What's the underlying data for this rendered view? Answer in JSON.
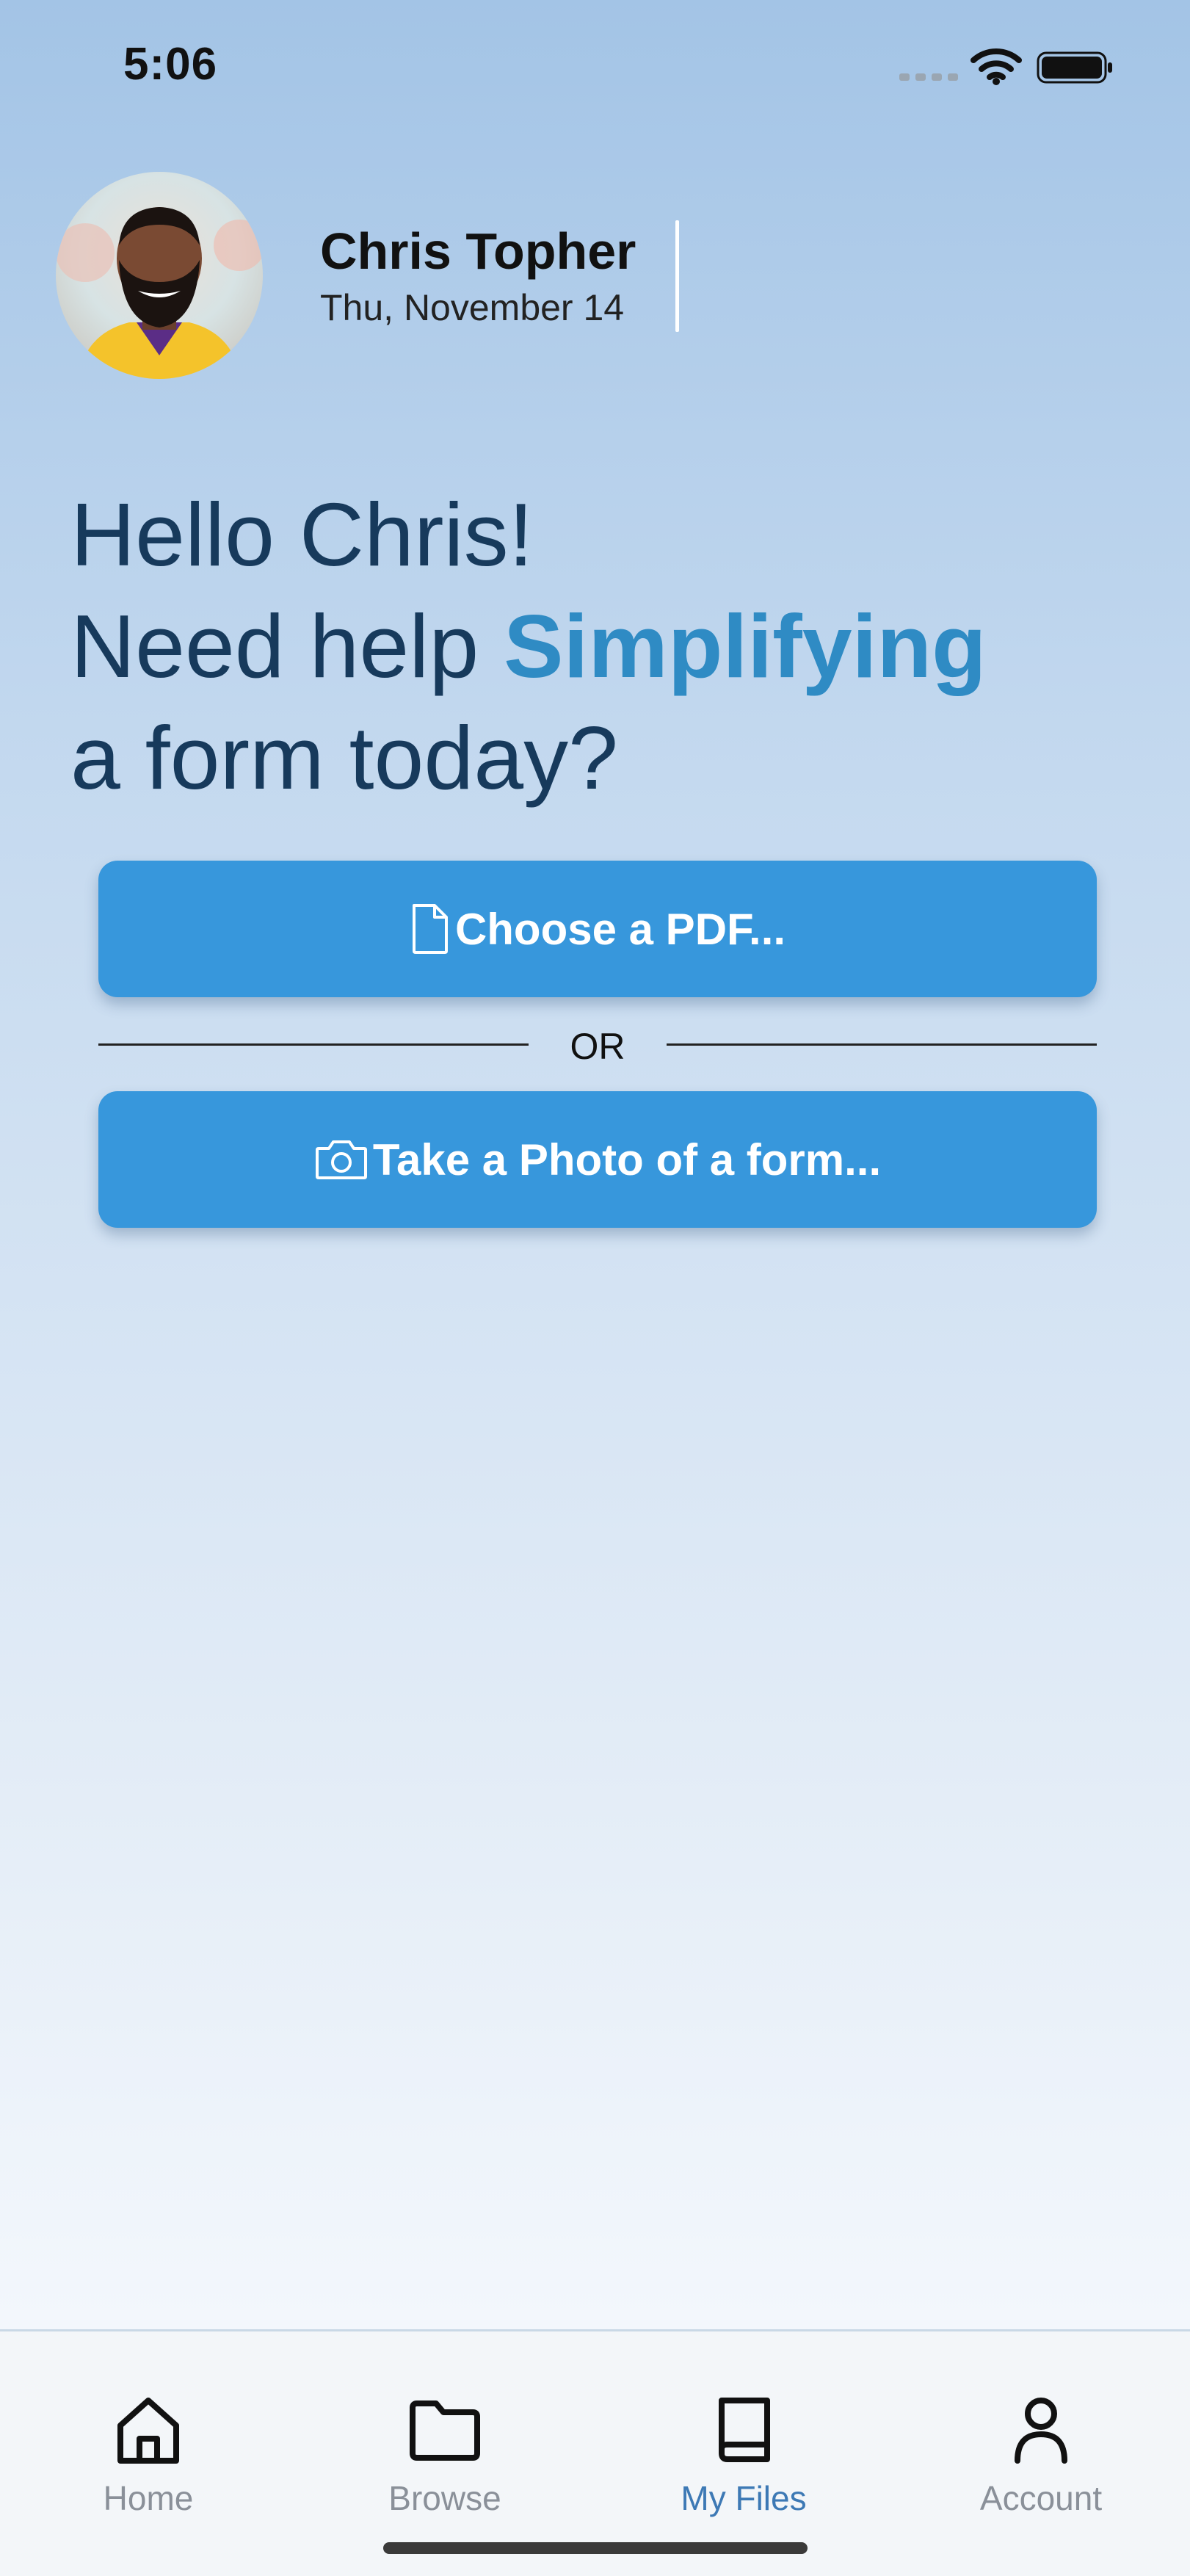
{
  "status_bar": {
    "time": "5:06"
  },
  "profile": {
    "name": "Chris Topher",
    "date": "Thu, November 14"
  },
  "greeting": {
    "line1": "Hello Chris!",
    "line2_prefix": "Need help ",
    "line2_accent": "Simplifying",
    "line3": "a form today?"
  },
  "actions": {
    "pdf_label": "Choose a PDF...",
    "or_label": "OR",
    "photo_label": "Take a Photo of a form..."
  },
  "tabs": [
    {
      "label": "Home",
      "icon": "home-icon"
    },
    {
      "label": "Browse",
      "icon": "folder-icon"
    },
    {
      "label": "My Files",
      "icon": "book-icon",
      "active": true
    },
    {
      "label": "Account",
      "icon": "person-icon"
    }
  ],
  "colors": {
    "accent": "#2f8bc4",
    "button": "#3797dc",
    "greeting_text": "#173a5c",
    "active_tab": "#3d79b5",
    "inactive_tab": "#8a9099"
  }
}
